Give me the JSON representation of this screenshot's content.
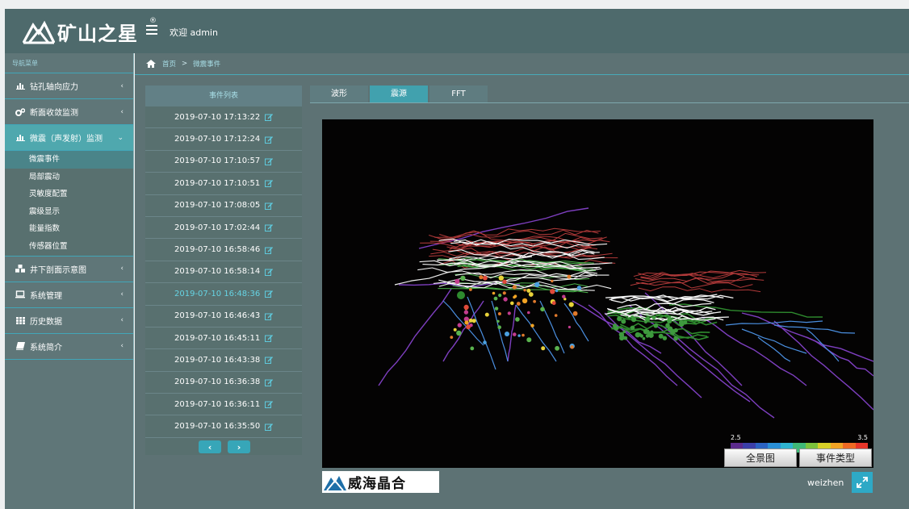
{
  "header": {
    "logo_text": "矿山之星",
    "logo_reg": "®",
    "welcome": "欢迎 admin"
  },
  "sidebar": {
    "title": "导航菜单",
    "items": [
      {
        "label": "钻孔轴向应力",
        "icon": "bar-chart-icon",
        "arrow": "‹"
      },
      {
        "label": "断面收敛监测",
        "icon": "gears-icon",
        "arrow": "‹"
      },
      {
        "label": "微震（声发射）监测",
        "icon": "bar-chart-icon",
        "arrow": "⌄",
        "expanded": true,
        "children": [
          "微震事件",
          "局部震动",
          "灵敏度配置",
          "震级显示",
          "能量指数",
          "传感器位置"
        ]
      },
      {
        "label": "井下剖面示意图",
        "icon": "cubes-icon",
        "arrow": "‹"
      },
      {
        "label": "系统管理",
        "icon": "laptop-icon",
        "arrow": "‹"
      },
      {
        "label": "历史数据",
        "icon": "grid-icon",
        "arrow": "‹"
      },
      {
        "label": "系统简介",
        "icon": "book-icon",
        "arrow": "‹"
      }
    ]
  },
  "breadcrumb": {
    "home": "首页",
    "sep": ">",
    "current": "微震事件"
  },
  "events": {
    "header": "事件列表",
    "rows": [
      "2019-07-10 17:13:22",
      "2019-07-10 17:12:24",
      "2019-07-10 17:10:57",
      "2019-07-10 17:10:51",
      "2019-07-10 17:08:05",
      "2019-07-10 17:02:44",
      "2019-07-10 16:58:46",
      "2019-07-10 16:58:14",
      "2019-07-10 16:48:36",
      "2019-07-10 16:46:43",
      "2019-07-10 16:45:11",
      "2019-07-10 16:43:38",
      "2019-07-10 16:36:38",
      "2019-07-10 16:36:11",
      "2019-07-10 16:35:50"
    ],
    "current_index": 8,
    "prev": "‹",
    "next": "›"
  },
  "tabs": [
    {
      "label": "波形",
      "active": false
    },
    {
      "label": "震源",
      "active": true
    },
    {
      "label": "FFT",
      "active": false
    }
  ],
  "viewer": {
    "colorbar_min": "2.5",
    "colorbar_max": "3.5",
    "colorbar_colors": [
      "#5b2a8c",
      "#3c3fa8",
      "#2c63c2",
      "#2a8fd6",
      "#2fb3cf",
      "#3fb877",
      "#7cc23b",
      "#d6cf27",
      "#f2a424",
      "#ef6a24",
      "#e6362a"
    ],
    "btn_full": "全景图",
    "btn_type": "事件类型"
  },
  "footer": {
    "brand": "威海晶合",
    "user": "weizhen"
  },
  "colors": {
    "topbar": "#4e6a6c",
    "sidebar": "#5f7678",
    "accent": "#41a1ae",
    "viewer_bg": "#040303"
  }
}
